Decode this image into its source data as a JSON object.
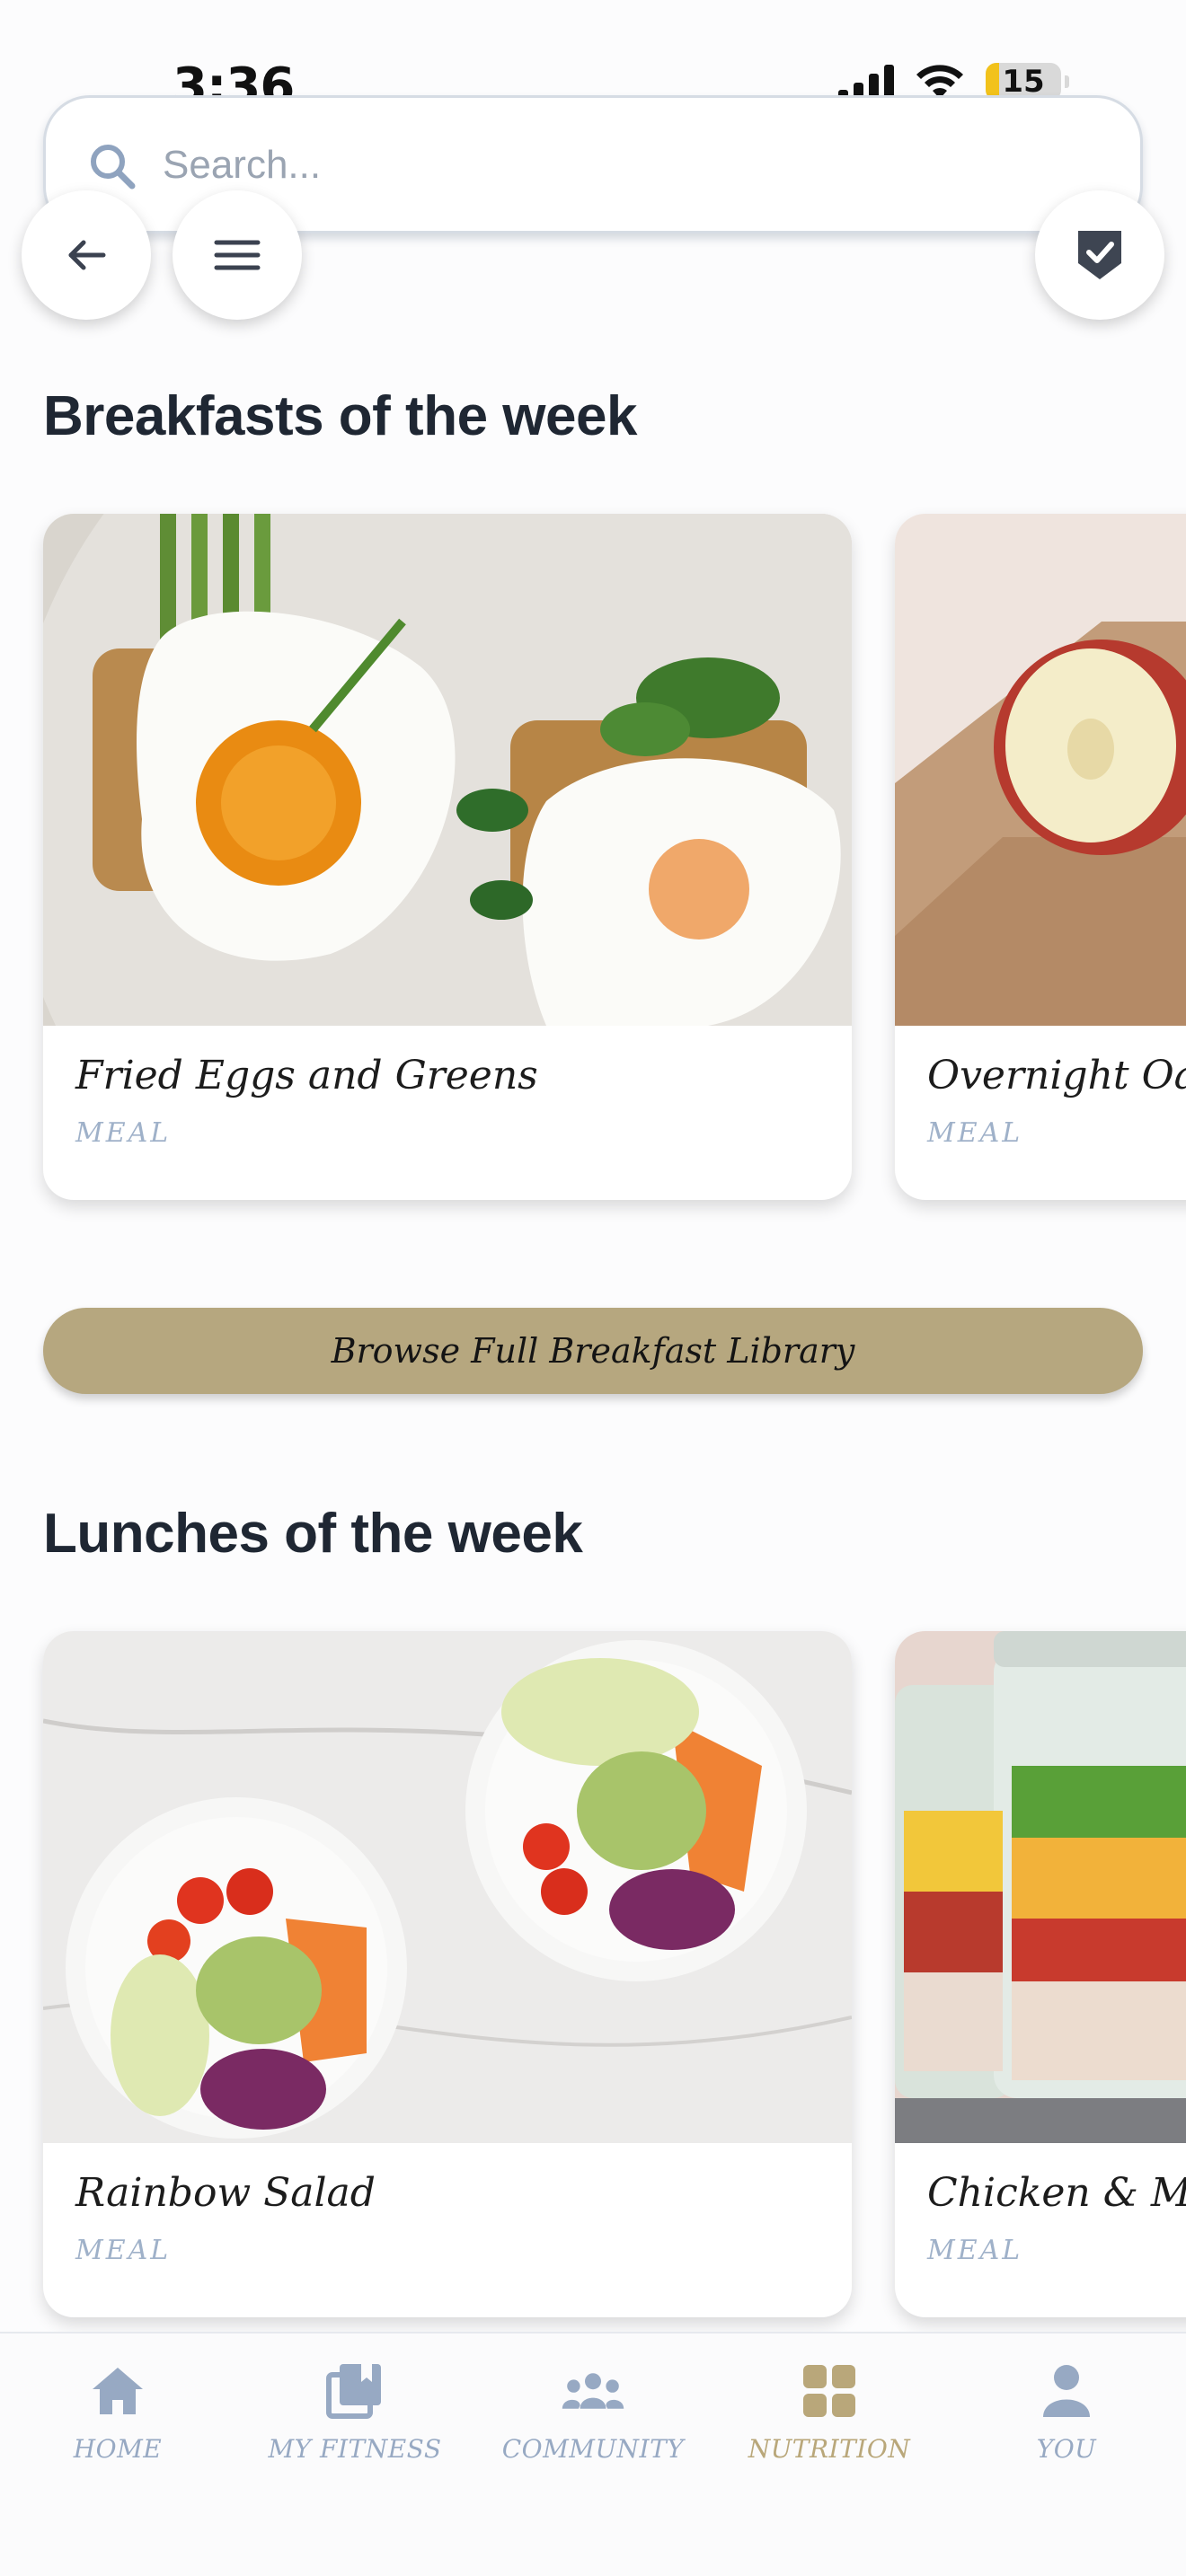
{
  "status_bar": {
    "time": "3:36",
    "battery": "15"
  },
  "search": {
    "placeholder": "Search..."
  },
  "sections": {
    "breakfast": {
      "title": "Breakfasts of the week",
      "cards": [
        {
          "title": "Fried Eggs and Greens",
          "tag": "MEAL"
        },
        {
          "title": "Overnight Oats",
          "tag": "MEAL"
        }
      ],
      "browse_label": "Browse Full Breakfast Library"
    },
    "lunch": {
      "title": "Lunches of the week",
      "cards": [
        {
          "title": "Rainbow Salad",
          "tag": "MEAL"
        },
        {
          "title": "Chicken & Mang",
          "tag": "MEAL"
        }
      ]
    }
  },
  "nav": {
    "items": [
      {
        "label": "HOME",
        "icon": "home-icon"
      },
      {
        "label": "MY FITNESS",
        "icon": "book-icon"
      },
      {
        "label": "COMMUNITY",
        "icon": "people-icon"
      },
      {
        "label": "NUTRITION",
        "icon": "grid-icon"
      },
      {
        "label": "YOU",
        "icon": "person-icon"
      }
    ],
    "active": "NUTRITION",
    "colors": {
      "inactive": "#97a9c3",
      "active": "#b9a77a"
    }
  },
  "colors": {
    "accent": "#b6a77f",
    "tag": "#9fb1c9",
    "title": "#1f2733"
  }
}
